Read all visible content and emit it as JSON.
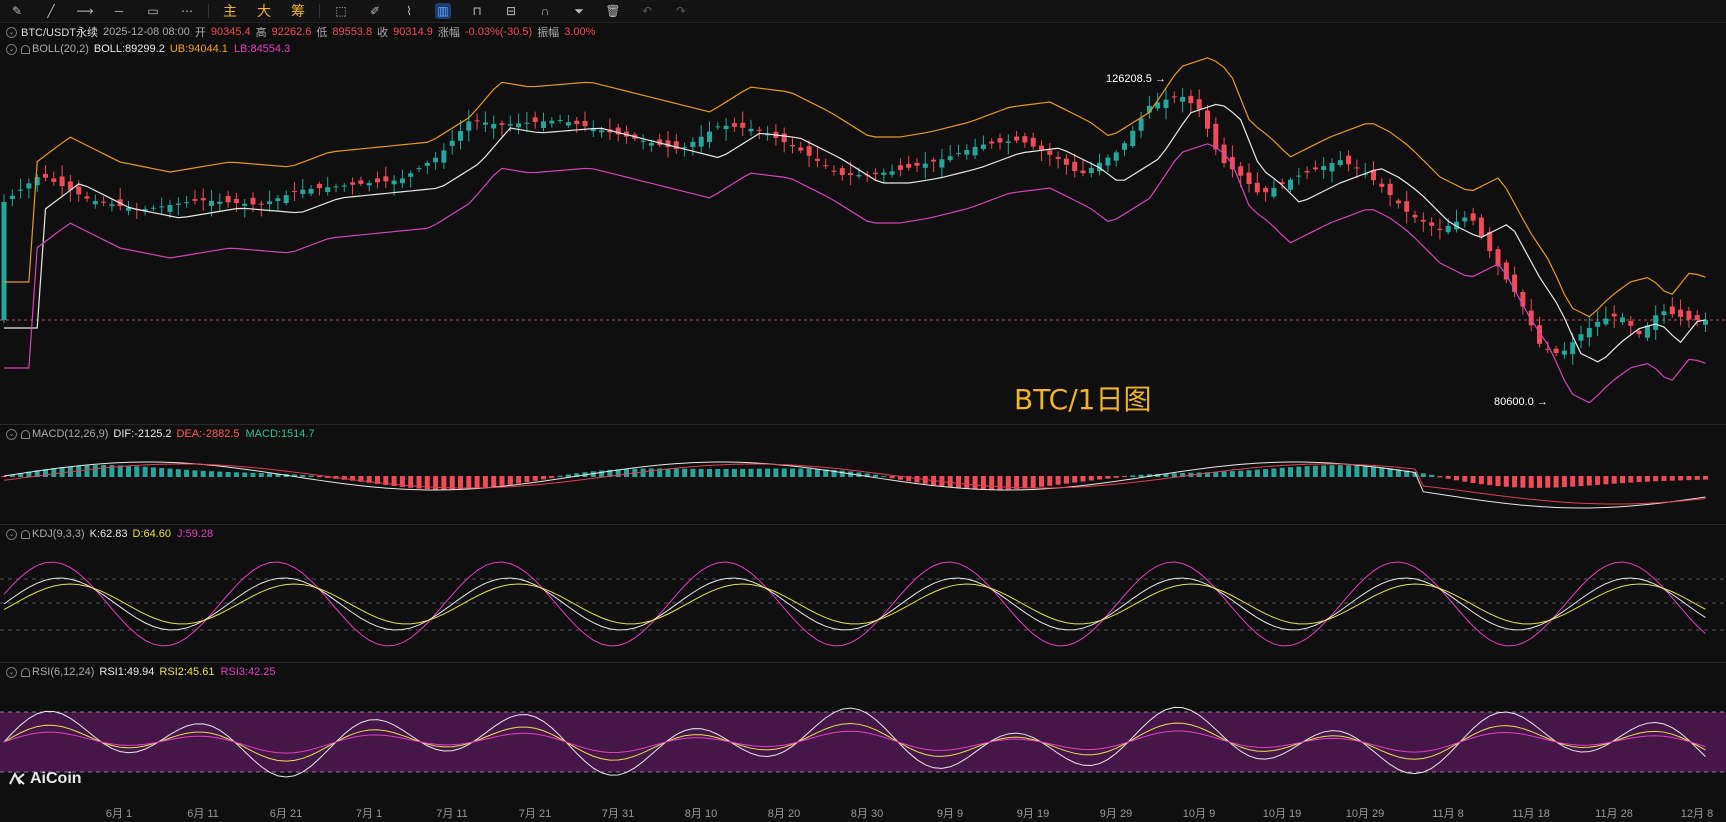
{
  "toolbar": {
    "tools": [
      "pen-icon",
      "draw-line-icon",
      "horizontal-ray-icon",
      "horizontal-line-icon",
      "rectangle-icon",
      "more-tools-icon"
    ],
    "period_labels": [
      "主",
      "大",
      "筹"
    ],
    "right_tools": [
      "select-tool-icon",
      "pencil-icon",
      "brush-icon",
      "measure-icon",
      "lock-icon",
      "hide-icon",
      "magnet-icon",
      "filter-icon",
      "delete-icon",
      "undo-icon",
      "redo-icon"
    ]
  },
  "header": {
    "symbol": "BTC/USDT永续",
    "datetime": "2025-12-08 08:00",
    "open_label": "开",
    "open": "90345.4",
    "high_label": "高",
    "high": "92262.6",
    "low_label": "低",
    "low": "89553.8",
    "close_label": "收",
    "close": "90314.9",
    "change_label": "涨幅",
    "change": "-0.03%(-30.5)",
    "amp_label": "振幅",
    "amp": "3.00%"
  },
  "boll": {
    "name": "BOLL(20,2)",
    "mid": "BOLL:89299.2",
    "ub": "UB:94044.1",
    "lb": "LB:84554.3"
  },
  "macd": {
    "name": "MACD(12,26,9)",
    "dif": "DIF:-2125.2",
    "dea": "DEA:-2882.5",
    "macd": "MACD:1514.7"
  },
  "kdj": {
    "name": "KDJ(9,3,3)",
    "k": "K:62.83",
    "d": "D:64.60",
    "j": "J:59.28"
  },
  "rsi": {
    "name": "RSI(6,12,24)",
    "rsi1": "RSI1:49.94",
    "rsi2": "RSI2:45.61",
    "rsi3": "RSI3:42.25"
  },
  "annotations": {
    "high_tag": "126208.5",
    "low_tag": "80600.0",
    "watermark": "BTC/1日图"
  },
  "x_axis": [
    "6月 1",
    "6月 11",
    "6月 21",
    "7月 1",
    "7月 11",
    "7月 21",
    "7月 31",
    "8月 10",
    "8月 20",
    "8月 30",
    "9月 9",
    "9月 19",
    "9月 29",
    "10月 9",
    "10月 19",
    "10月 29",
    "11月 8",
    "11月 18",
    "11月 28",
    "12月 8"
  ],
  "brand": "AiCoin",
  "colors": {
    "up": "#26a69a",
    "down": "#ef4b5a",
    "mid": "#e8e8e8",
    "ub": "#e59b20",
    "lb": "#d046b8",
    "rsi_band": "#5a1a5c"
  }
}
